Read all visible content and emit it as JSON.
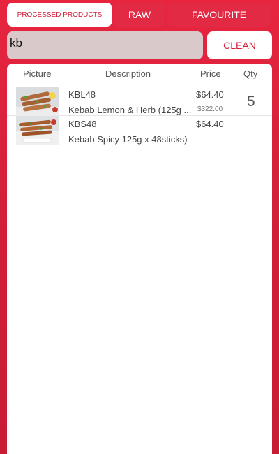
{
  "tabs": [
    {
      "label": "PROCESSED PRODUCTS",
      "active": true
    },
    {
      "label": "RAW",
      "active": false
    },
    {
      "label": "FAVOURITE",
      "active": false
    }
  ],
  "search": {
    "value": "kb",
    "placeholder": ""
  },
  "clean_button": {
    "label": "CLEAN"
  },
  "table": {
    "headers": {
      "picture": "Picture",
      "description": "Description",
      "price": "Price",
      "qty": "Qty"
    },
    "rows": [
      {
        "code": "KBL48",
        "description": "Kebab Lemon & Herb (125g ...",
        "price": "$64.40",
        "total": "$322.00",
        "qty": "5"
      },
      {
        "code": "KBS48",
        "description": "Kebab Spicy 125g x 48sticks)",
        "price": "$64.40",
        "total": "",
        "qty": ""
      }
    ]
  },
  "colors": {
    "brand": "#d21f3a",
    "background": "#e8253f",
    "search_bg": "#d9c9cb"
  }
}
